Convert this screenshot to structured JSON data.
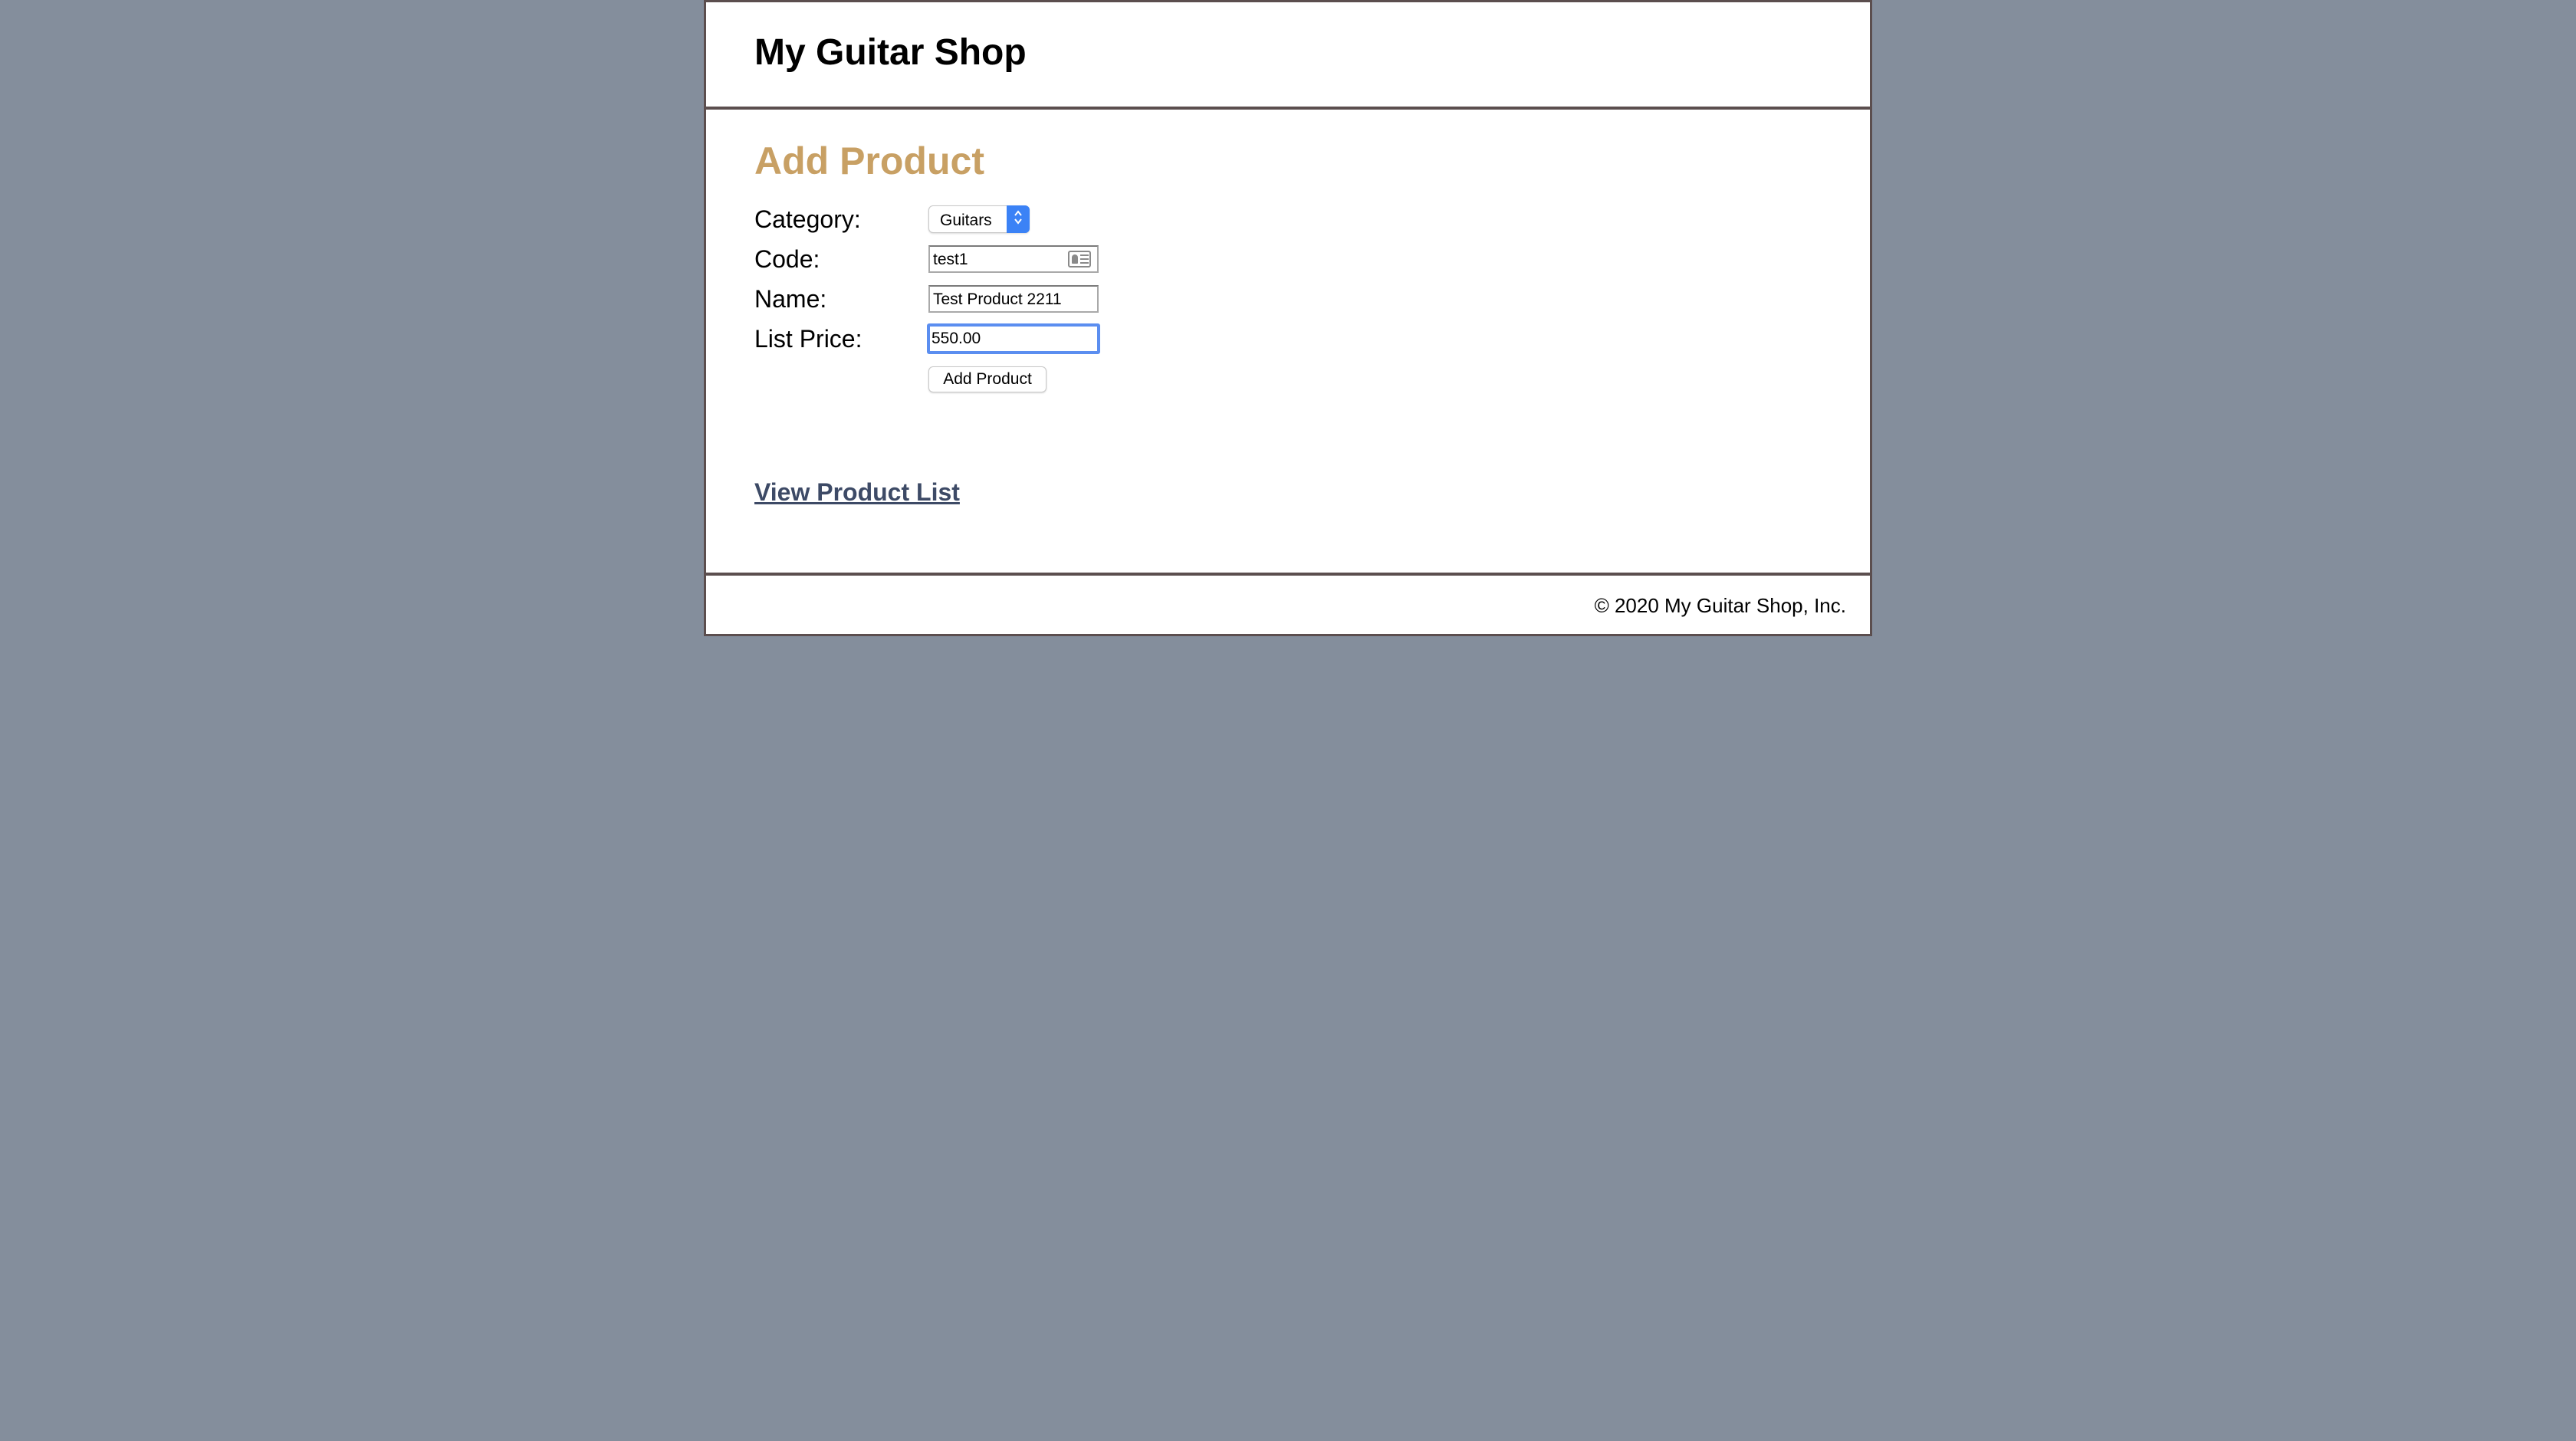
{
  "header": {
    "title": "My Guitar Shop"
  },
  "main": {
    "heading": "Add Product",
    "form": {
      "category_label": "Category:",
      "category_value": "Guitars",
      "code_label": "Code:",
      "code_value": "test1",
      "name_label": "Name:",
      "name_value": "Test Product 2211",
      "price_label": "List Price:",
      "price_value": "550.00",
      "submit_label": "Add Product"
    },
    "link_label": "View Product List"
  },
  "footer": {
    "copyright": "© 2020 My Guitar Shop, Inc."
  },
  "icons": {
    "select_arrows": "chevron-up-down-icon",
    "autofill": "contact-card-icon"
  },
  "colors": {
    "background": "#848e9c",
    "heading": "#c8a064",
    "link": "#3d4a66",
    "border": "#5b4e4e",
    "focus": "#5b8ef0",
    "select_accent": "#3b82f6"
  }
}
